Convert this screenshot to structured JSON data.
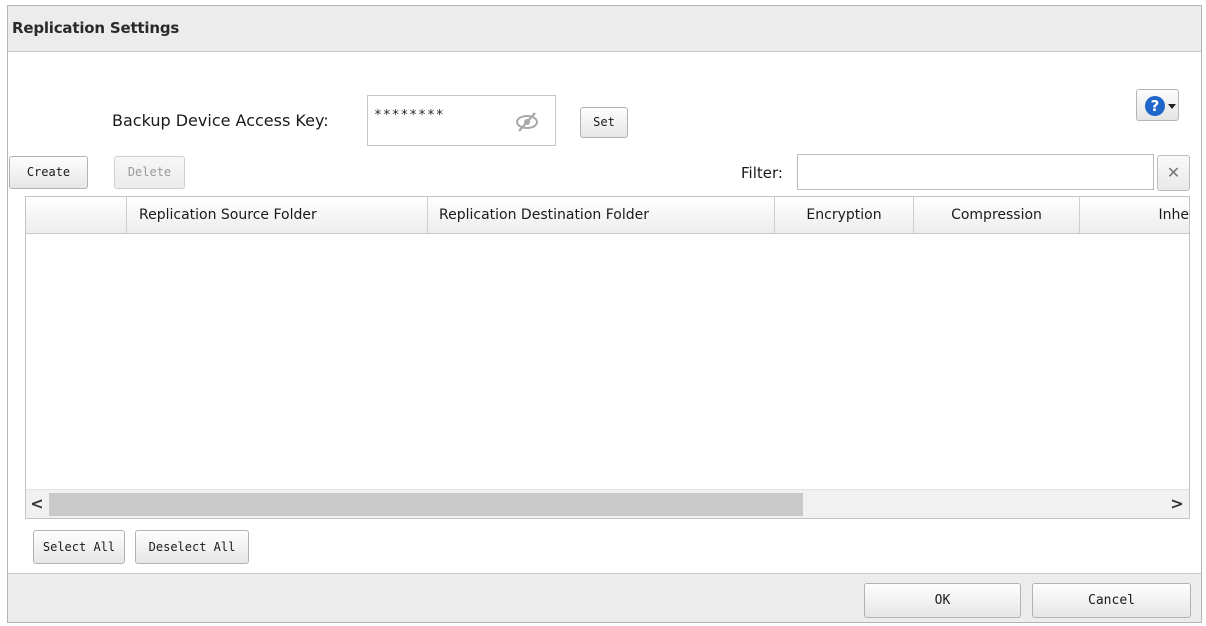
{
  "dialog": {
    "title": "Replication Settings"
  },
  "help": {
    "icon": "help-icon",
    "glyph": "?"
  },
  "access_key": {
    "label": "Backup Device Access Key:",
    "value": "********",
    "toggle_icon": "eye-slash-icon",
    "set_label": "Set"
  },
  "toolbar": {
    "create_label": "Create",
    "delete_label": "Delete",
    "filter_label": "Filter:",
    "filter_value": "",
    "clear_glyph": "✕"
  },
  "table": {
    "columns": [
      {
        "label": ""
      },
      {
        "label": "Replication Source Folder"
      },
      {
        "label": "Replication Destination Folder"
      },
      {
        "label": "Encryption"
      },
      {
        "label": "Compression"
      },
      {
        "label": "Inhe"
      }
    ],
    "rows": []
  },
  "scroll": {
    "left_glyph": "<",
    "right_glyph": ">"
  },
  "selection": {
    "select_all_label": "Select All",
    "deselect_all_label": "Deselect All"
  },
  "footer": {
    "ok_label": "OK",
    "cancel_label": "Cancel"
  },
  "colors": {
    "help_blue": "#1e66c9",
    "dialog_bg": "#ececec",
    "content_bg": "#ffffff"
  }
}
